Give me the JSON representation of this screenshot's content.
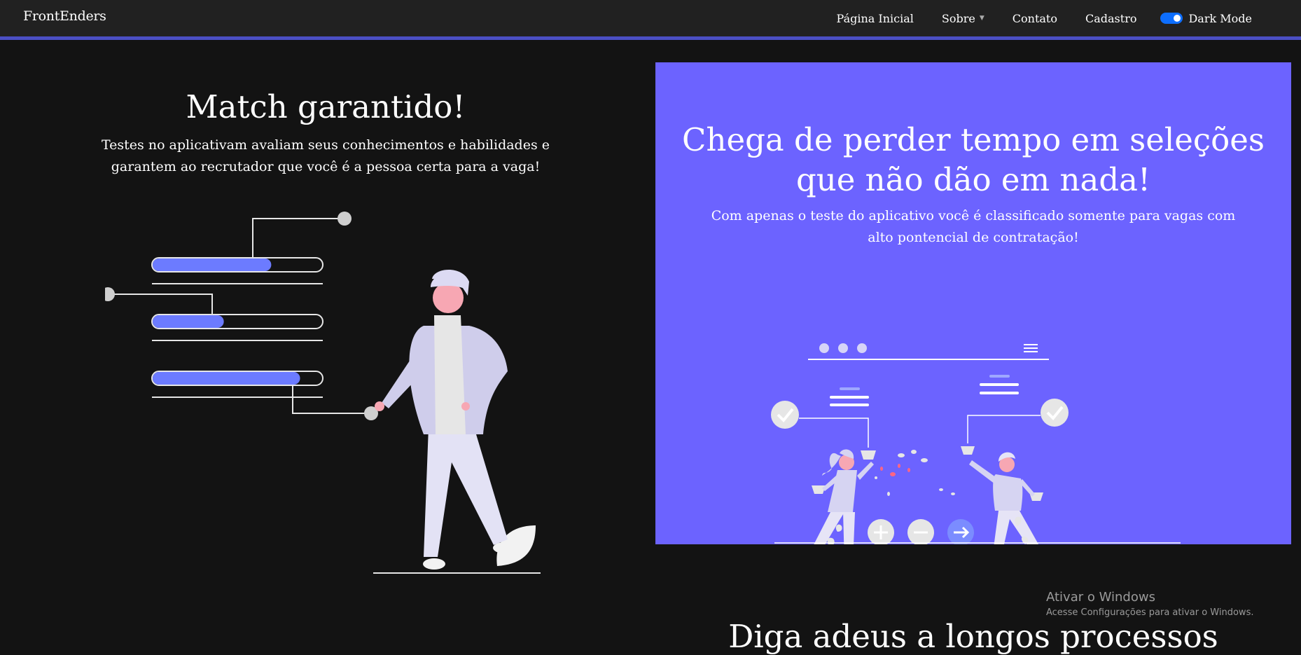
{
  "navbar": {
    "brand": "FrontEnders",
    "links": [
      {
        "label": "Página Inicial"
      },
      {
        "label": "Sobre"
      },
      {
        "label": "Contato"
      },
      {
        "label": "Cadastro"
      }
    ],
    "dark_mode_label": "Dark Mode",
    "dark_mode_on": true
  },
  "left_section": {
    "title": "Match garantido!",
    "text": "Testes no aplicativam avaliam seus conhecimentos e habilidades e garantem ao recrutador que você é a pessoa certa para a vaga!",
    "progress_levels": [
      0.7,
      0.42,
      0.87
    ]
  },
  "right_section": {
    "title": "Chega de perder tempo em seleções que não dão em nada!",
    "text": "Com apenas o teste do aplicativo você é classificado somente para vagas com alto pontencial de contratação!"
  },
  "watermark": {
    "title": "Ativar o Windows",
    "subtitle": "Acesse Configurações para ativar o Windows."
  },
  "next_section": {
    "title": "Diga adeus a longos processos"
  },
  "colors": {
    "background": "#131313",
    "navbar": "#212121",
    "accent": "#6c63ff",
    "toggle": "#0d6efd"
  }
}
